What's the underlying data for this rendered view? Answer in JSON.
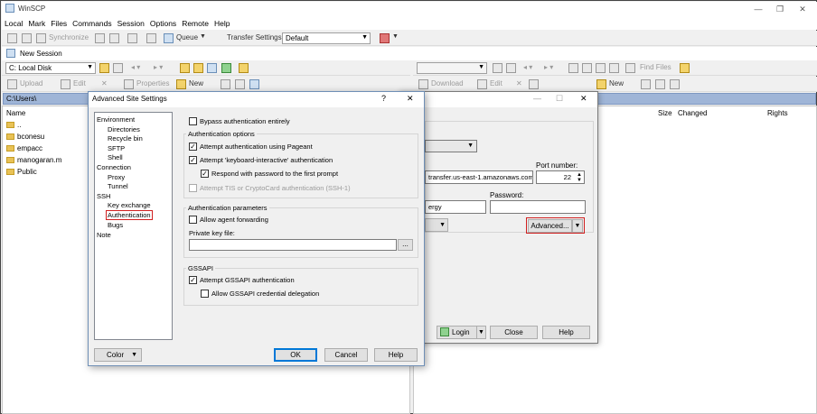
{
  "app": {
    "title": "WinSCP",
    "win_minimize": "—",
    "win_restore": "❐",
    "win_close": "✕"
  },
  "menu": [
    "Local",
    "Mark",
    "Files",
    "Commands",
    "Session",
    "Options",
    "Remote",
    "Help"
  ],
  "toolbar1": {
    "synchronize": "Synchronize",
    "queue": "Queue",
    "transfer_settings_label": "Transfer Settings",
    "transfer_settings_value": "Default"
  },
  "session_tab": {
    "label": "New Session"
  },
  "local": {
    "drive": "C: Local Disk",
    "upload": "Upload",
    "edit": "Edit",
    "properties": "Properties",
    "new": "New",
    "path": "C:\\Users\\",
    "col_name": "Name",
    "files": [
      "..",
      "bconesu",
      "empacc",
      "manogaran.m",
      "Public"
    ]
  },
  "remote": {
    "find_files": "Find Files",
    "download": "Download",
    "edit": "Edit",
    "new": "New",
    "col_size": "Size",
    "col_changed": "Changed",
    "col_rights": "Rights"
  },
  "login": {
    "host": "transfer.us-east-1.amazonaws.com",
    "port_label": "Port number:",
    "port": "22",
    "user_partial": "ergy",
    "password_label": "Password:",
    "advanced": "Advanced...",
    "login_btn": "Login",
    "close_btn": "Close",
    "help_btn": "Help"
  },
  "advanced": {
    "title": "Advanced Site Settings",
    "help_q": "?",
    "close_x": "✕",
    "tree": [
      "Environment",
      "Directories",
      "Recycle bin",
      "SFTP",
      "Shell",
      "Connection",
      "Proxy",
      "Tunnel",
      "SSH",
      "Key exchange",
      "Authentication",
      "Bugs",
      "Note"
    ],
    "bypass": "Bypass authentication entirely",
    "auth_options_title": "Authentication options",
    "pageant": "Attempt authentication using Pageant",
    "keyboard": "Attempt 'keyboard-interactive' authentication",
    "respond": "Respond with password to the first prompt",
    "tis": "Attempt TIS or CryptoCard authentication (SSH-1)",
    "auth_params_title": "Authentication parameters",
    "agent_fwd": "Allow agent forwarding",
    "private_key_label": "Private key file:",
    "browse": "...",
    "gssapi_title": "GSSAPI",
    "gssapi_attempt": "Attempt GSSAPI authentication",
    "gssapi_deleg": "Allow GSSAPI credential delegation",
    "color_btn": "Color",
    "ok": "OK",
    "cancel": "Cancel",
    "help": "Help"
  },
  "colors": {
    "selection_box": "#d02020",
    "path_bar": "#9fb5d7",
    "default_button": "#0078d7"
  }
}
